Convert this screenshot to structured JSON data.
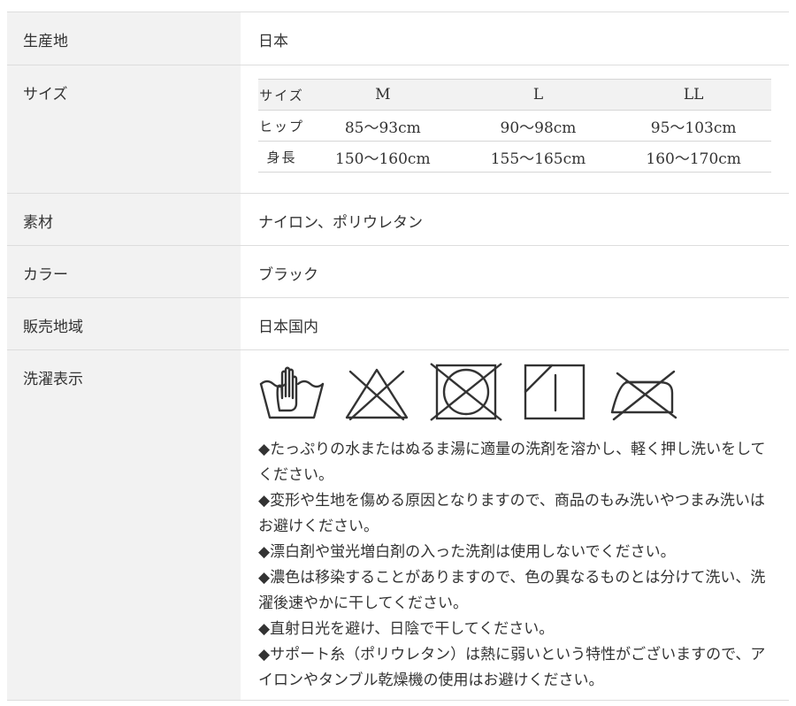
{
  "spec": {
    "origin": {
      "label": "生産地",
      "value": "日本"
    },
    "size": {
      "label": "サイズ",
      "table": {
        "header": [
          "サイズ",
          "M",
          "L",
          "LL"
        ],
        "rows": [
          [
            "ヒップ",
            "85〜93cm",
            "90〜98cm",
            "95〜103cm"
          ],
          [
            "身長",
            "150〜160cm",
            "155〜165cm",
            "160〜170cm"
          ]
        ]
      }
    },
    "material": {
      "label": "素材",
      "value": "ナイロン、ポリウレタン"
    },
    "color": {
      "label": "カラー",
      "value": "ブラック"
    },
    "region": {
      "label": "販売地域",
      "value": "日本国内"
    },
    "care": {
      "label": "洗濯表示",
      "icons": [
        "hand-wash-icon",
        "no-bleach-icon",
        "no-tumble-dry-icon",
        "drip-dry-shade-icon",
        "no-iron-icon"
      ],
      "notes": [
        "◆たっぷりの水またはぬるま湯に適量の洗剤を溶かし、軽く押し洗いをしてください。",
        "◆変形や生地を傷める原因となりますので、商品のもみ洗いやつまみ洗いはお避けください。",
        "◆漂白剤や蛍光増白剤の入った洗剤は使用しないでください。",
        "◆濃色は移染することがありますので、色の異なるものとは分けて洗い、洗濯後速やかに干してください。",
        "◆直射日光を避け、日陰で干してください。",
        "◆サポート糸（ポリウレタン）は熱に弱いという特性がございますので、アイロンやタンブル乾燥機の使用はお避けください。"
      ]
    }
  },
  "colors": {
    "label_bg": "#f2f2f2",
    "border": "#dddddd",
    "text": "#333333"
  }
}
